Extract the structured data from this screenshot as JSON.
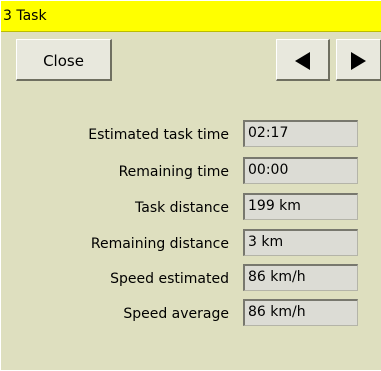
{
  "dialog": {
    "title": "3 Task"
  },
  "toolbar": {
    "close_label": "Close",
    "prev_icon": "arrow-left-icon",
    "next_icon": "arrow-right-icon"
  },
  "stats": [
    {
      "label": "Estimated task time",
      "value": "02:17"
    },
    {
      "label": "Remaining time",
      "value": "00:00"
    },
    {
      "label": "Task distance",
      "value": "199 km"
    },
    {
      "label": "Remaining distance",
      "value": "3 km"
    },
    {
      "label": "Speed estimated",
      "value": "86 km/h"
    },
    {
      "label": "Speed average",
      "value": "86 km/h"
    }
  ],
  "colors": {
    "titlebar": "#ffff00",
    "background": "#dedfbf"
  }
}
